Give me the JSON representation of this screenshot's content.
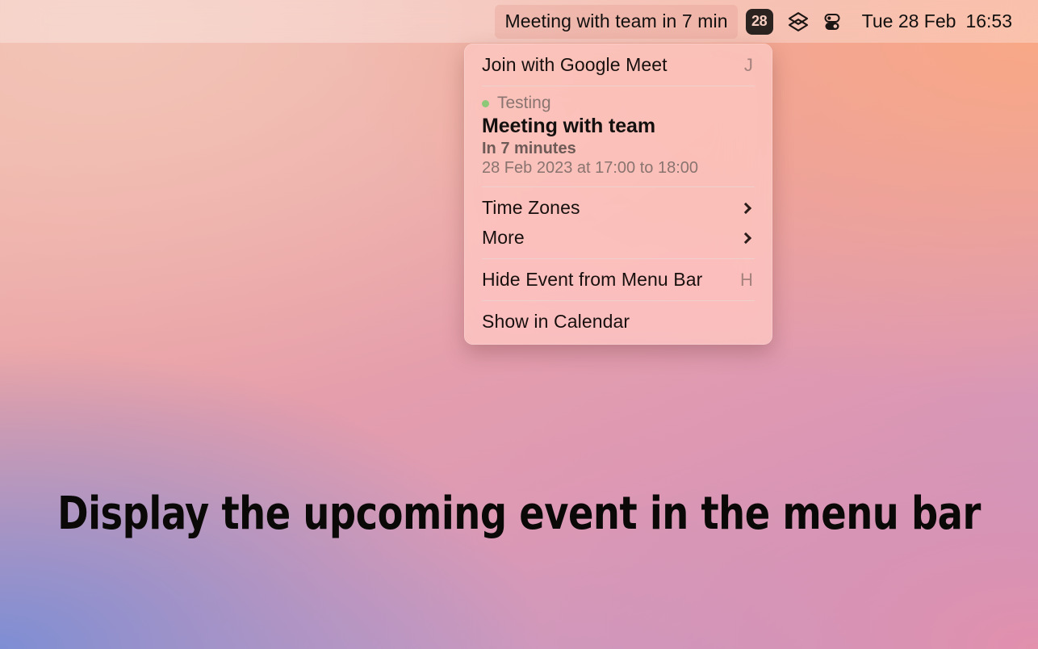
{
  "menubar": {
    "event_item": {
      "label": "Meeting with team in 7 min",
      "active": true
    },
    "date_badge": "28",
    "icons": [
      {
        "name": "layers-icon"
      },
      {
        "name": "control-center-icon"
      }
    ],
    "clock": {
      "date": "Tue 28 Feb",
      "time": "16:53"
    }
  },
  "menu": {
    "join": {
      "label": "Join with Google Meet",
      "shortcut": "J"
    },
    "event": {
      "calendar_name": "Testing",
      "calendar_color": "#8cc878",
      "title": "Meeting with team",
      "relative_time": "In 7 minutes",
      "time_range": "28 Feb 2023 at 17:00 to 18:00"
    },
    "time_zones": {
      "label": "Time Zones"
    },
    "more": {
      "label": "More"
    },
    "hide_event": {
      "label": "Hide Event from Menu Bar",
      "shortcut": "H"
    },
    "show_in_calendar": {
      "label": "Show in Calendar"
    }
  },
  "headline": "Display the upcoming event in the menu bar",
  "colors": {
    "accent_green": "#8cc878",
    "badge_bg": "#2b2320",
    "badge_text": "#f7cec2",
    "menu_bg": "rgba(250,200,195,0.80)"
  }
}
